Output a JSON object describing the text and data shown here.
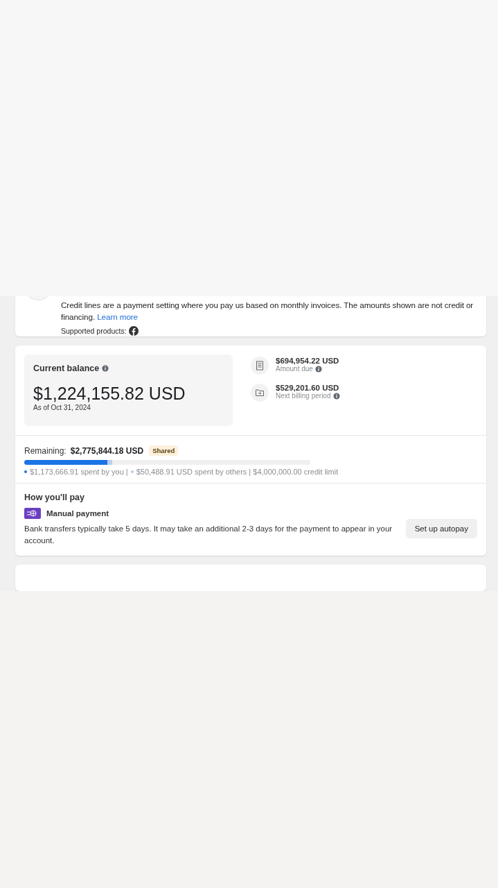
{
  "intro": {
    "text": "Credit lines are a payment setting where you pay us based on monthly invoices. The amounts shown are not credit or financing.",
    "link": "Learn more",
    "supported_label": "Supported products:"
  },
  "balance": {
    "title": "Current balance",
    "amount": "$1,224,155.82 USD",
    "as_of": "As of Oct 31, 2024",
    "side": [
      {
        "kind": "invoice",
        "amount": "$694,954.22 USD",
        "label": "Amount due"
      },
      {
        "kind": "folder",
        "amount": "$529,201.60 USD",
        "label": "Next billing period"
      }
    ]
  },
  "remaining": {
    "label": "Remaining:",
    "amount": "$2,775,844.18 USD",
    "badge": "Shared",
    "bar": [
      {
        "level": 0.29,
        "color": "#1b74e4"
      },
      {
        "color": "#b9cdf0"
      }
    ],
    "legend": [
      {
        "color": "#1b74e4",
        "text": "$1,173,666.91 spent by you |"
      },
      {
        "color": "#b9cdf0",
        "text": "$50,488.91 USD spent by others | $4,000,000.00 credit limit"
      }
    ]
  },
  "payment": {
    "title": "How you'll pay",
    "method": "Manual payment",
    "note": "Bank transfers typically take 5 days. It may take an additional 2-3 days for the payment to appear in your account.",
    "button": "Set up autopay"
  }
}
